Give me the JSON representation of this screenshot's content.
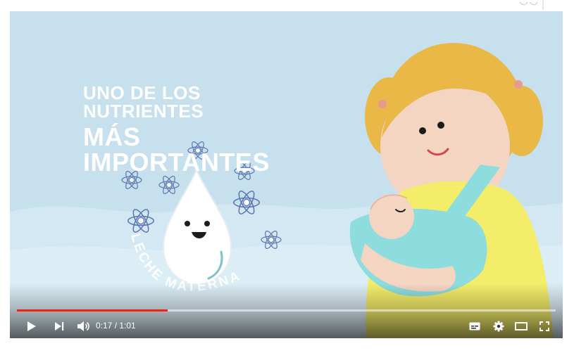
{
  "video": {
    "headline_line1": "UNO DE LOS NUTRIENTES",
    "headline_line2": "MÁS IMPORTANTES",
    "drop_label": "LECHE MATERNA"
  },
  "player": {
    "progress_fraction": 0.28,
    "current_time": "0:17",
    "separator": " / ",
    "duration": "1:01",
    "accent_color": "#f0231c"
  },
  "icons": {
    "play": "play-icon",
    "next": "next-icon",
    "volume": "volume-icon",
    "subtitles": "subtitles-icon",
    "settings": "gear-icon",
    "theater": "theater-mode-icon",
    "fullscreen": "fullscreen-icon"
  }
}
